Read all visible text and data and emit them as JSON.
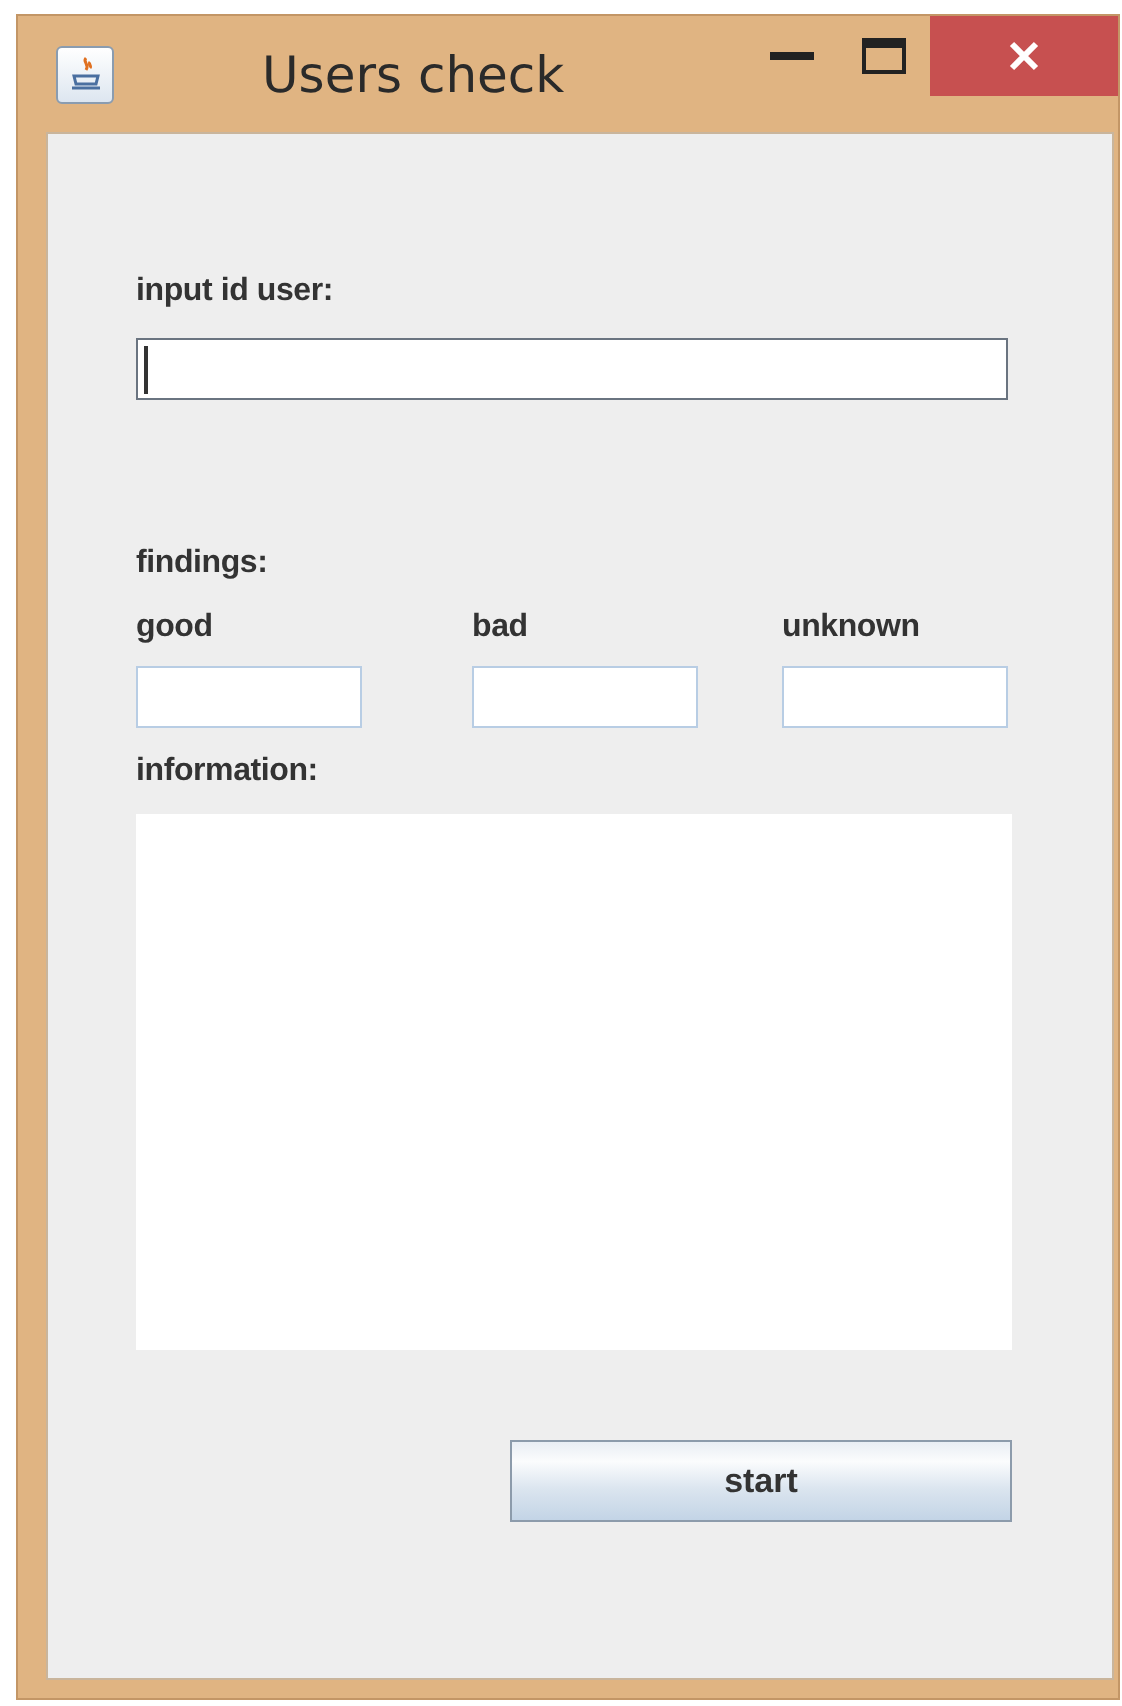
{
  "window": {
    "title": "Users check"
  },
  "id_field": {
    "label": "input id user:",
    "focused": true
  },
  "findings": {
    "label": "findings:",
    "counters": [
      {
        "label": "good"
      },
      {
        "label": "bad"
      },
      {
        "label": "unknown"
      }
    ]
  },
  "information": {
    "label": "information:"
  },
  "button": {
    "label": "start"
  }
}
